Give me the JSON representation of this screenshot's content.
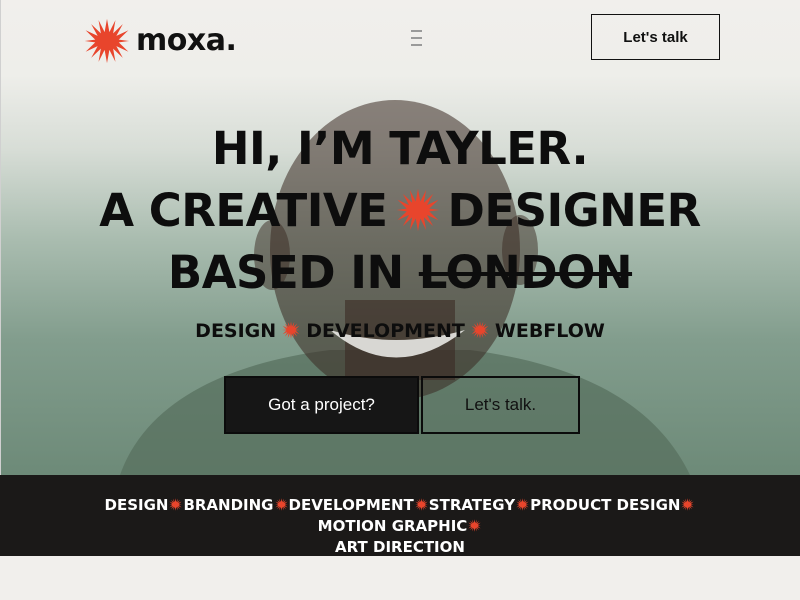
{
  "brand": {
    "name": "moxa.",
    "accent": "#e8452c"
  },
  "header": {
    "menu_icon": "hamburger-icon",
    "cta_label": "Let's talk"
  },
  "hero": {
    "line1": "HI, I’M TAYLER.",
    "line2_a": "A CREATIVE",
    "line2_b": "DESIGNER",
    "line3_a": "BASED IN",
    "line3_struck": "LONDON",
    "tags": [
      "DESIGN",
      "DEVELOPMENT",
      "WEBFLOW"
    ],
    "primary_button": "Got a project?",
    "secondary_button": "Let's talk."
  },
  "services": [
    "DESIGN",
    "BRANDING",
    "DEVELOPMENT",
    "STRATEGY",
    "PRODUCT DESIGN",
    "MOTION GRAPHIC",
    "ART DIRECTION"
  ],
  "colors": {
    "background": "#f1efec",
    "dark": "#1b1918",
    "star": "#e8452c"
  }
}
